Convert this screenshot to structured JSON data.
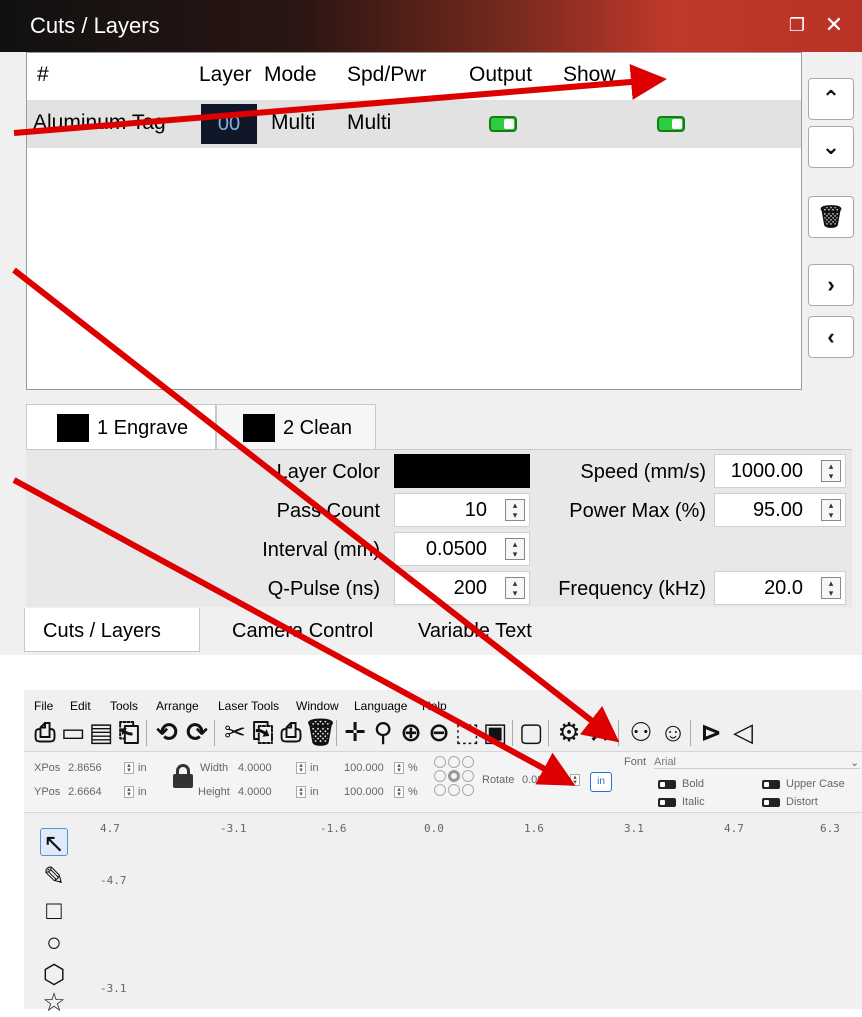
{
  "panel": {
    "title": "Cuts / Layers",
    "float_icon": "float-icon",
    "close_icon": "close-icon",
    "columns": [
      "#",
      "Layer",
      "Mode",
      "Spd/Pwr",
      "Output",
      "Show"
    ],
    "rows": [
      {
        "name": "Aluminum Tag",
        "layer": "00",
        "mode": "Multi",
        "spdpwr": "Multi",
        "output": true,
        "show": true
      }
    ],
    "side_buttons": [
      "chevron-up-icon",
      "chevron-down-icon",
      "trash-icon",
      "chevron-right-icon",
      "chevron-left-icon"
    ],
    "sub_tabs": [
      {
        "label": "1 Engrave",
        "color": "#000000"
      },
      {
        "label": "2 Clean",
        "color": "#000000"
      }
    ],
    "settings": {
      "layer_color_label": "Layer Color",
      "pass_count_label": "Pass Count",
      "pass_count": "10",
      "interval_label": "Interval (mm)",
      "interval": "0.0500",
      "qpulse_label": "Q-Pulse (ns)",
      "qpulse": "200",
      "speed_label": "Speed (mm/s)",
      "speed": "1000.00",
      "power_label": "Power Max (%)",
      "power": "95.00",
      "frequency_label": "Frequency (kHz)",
      "frequency": "20.0"
    },
    "bottom_tabs": [
      "Cuts / Layers",
      "Camera Control",
      "Variable Text"
    ]
  },
  "app": {
    "menu": [
      "File",
      "Edit",
      "Tools",
      "Arrange",
      "Laser Tools",
      "Window",
      "Language",
      "Help"
    ],
    "props": {
      "xpos_label": "XPos",
      "xpos": "2.8656",
      "xunit": "in",
      "ypos_label": "YPos",
      "ypos": "2.6664",
      "yunit": "in",
      "width_label": "Width",
      "width": "4.0000",
      "wunit": "in",
      "height_label": "Height",
      "height": "4.0000",
      "hunit": "in",
      "wpct": "100.000",
      "hpct": "100.000",
      "pct_unit": "%",
      "rotate_label": "Rotate",
      "rotate": "0.00",
      "unit_button": "in",
      "font_label": "Font",
      "font_value": "Arial",
      "bold": "Bold",
      "italic": "Italic",
      "upper": "Upper Case",
      "distort": "Distort"
    },
    "ruler_top": [
      "4.7",
      "-3.1",
      "-1.6",
      "0.0",
      "1.6",
      "3.1",
      "4.7",
      "6.3"
    ],
    "ruler_left": [
      "-4.7",
      "-3.1"
    ]
  },
  "colors": {
    "annotation_arrow": "#dd0000",
    "toggle_on": "#2ecc40",
    "layer_num_bg": "#101728"
  }
}
